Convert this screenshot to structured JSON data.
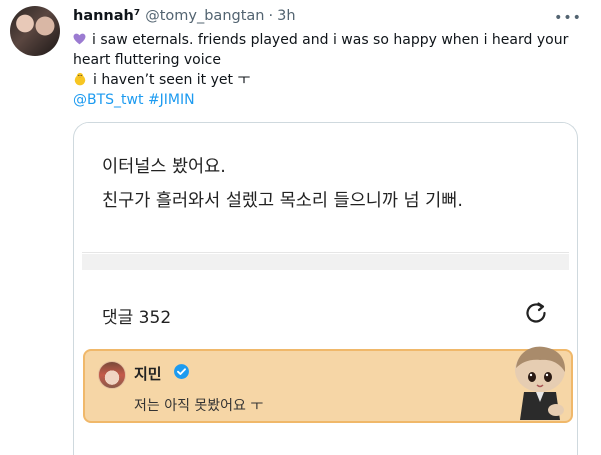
{
  "tweet": {
    "display_name": "hannah⁷",
    "handle": "@tomy_bangtan",
    "separator": "·",
    "time": "3h",
    "more_label": "•••",
    "lines": [
      "i saw eternals. friends played and i was so happy when i heard your",
      "heart fluttering voice",
      "i haven’t seen it yet ㅜ"
    ],
    "mentions": "@BTS_twt",
    "hashtag": "#JIMIN"
  },
  "card": {
    "post_line1": "이터널스 봤어요.",
    "post_line2": "친구가 흘러와서 설렜고 목소리 들으니까 넘 기뻐.",
    "comment_count": "댓글 352",
    "reply_name": "지민",
    "reply_text": "저는 아직 못봤어요 ㅜ"
  },
  "colors": {
    "link": "#1d9bf0",
    "heart_emoji": "#9b7bd1",
    "reply_bg": "#f6d6a6",
    "reply_border": "#f0b86a",
    "verified": "#1d9bf0"
  },
  "icons": [
    "purple-heart-icon",
    "chick-icon",
    "more-icon",
    "refresh-icon",
    "verified-icon"
  ]
}
